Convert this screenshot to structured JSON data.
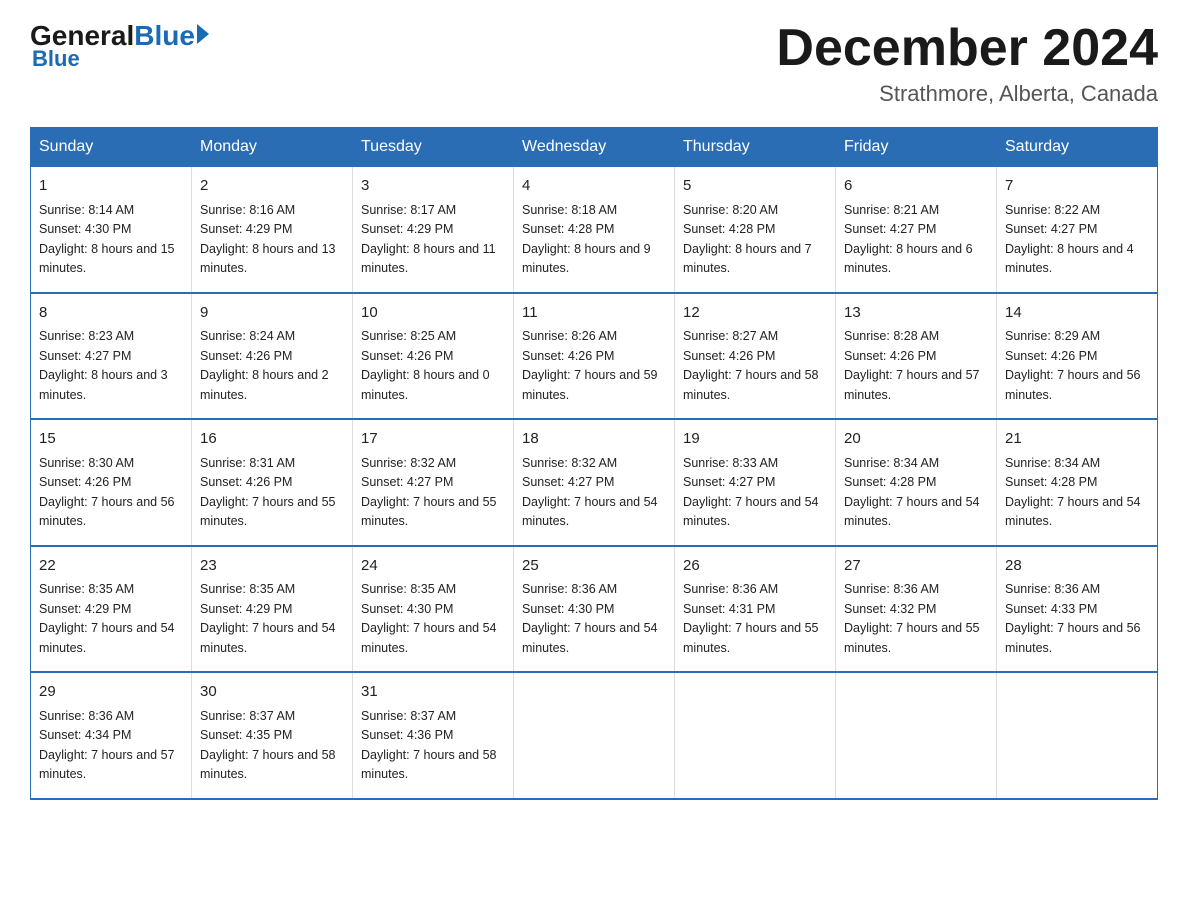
{
  "header": {
    "logo": {
      "general": "General",
      "blue": "Blue"
    },
    "title": "December 2024",
    "location": "Strathmore, Alberta, Canada"
  },
  "weekdays": [
    "Sunday",
    "Monday",
    "Tuesday",
    "Wednesday",
    "Thursday",
    "Friday",
    "Saturday"
  ],
  "weeks": [
    [
      {
        "day": "1",
        "sunrise": "Sunrise: 8:14 AM",
        "sunset": "Sunset: 4:30 PM",
        "daylight": "Daylight: 8 hours and 15 minutes."
      },
      {
        "day": "2",
        "sunrise": "Sunrise: 8:16 AM",
        "sunset": "Sunset: 4:29 PM",
        "daylight": "Daylight: 8 hours and 13 minutes."
      },
      {
        "day": "3",
        "sunrise": "Sunrise: 8:17 AM",
        "sunset": "Sunset: 4:29 PM",
        "daylight": "Daylight: 8 hours and 11 minutes."
      },
      {
        "day": "4",
        "sunrise": "Sunrise: 8:18 AM",
        "sunset": "Sunset: 4:28 PM",
        "daylight": "Daylight: 8 hours and 9 minutes."
      },
      {
        "day": "5",
        "sunrise": "Sunrise: 8:20 AM",
        "sunset": "Sunset: 4:28 PM",
        "daylight": "Daylight: 8 hours and 7 minutes."
      },
      {
        "day": "6",
        "sunrise": "Sunrise: 8:21 AM",
        "sunset": "Sunset: 4:27 PM",
        "daylight": "Daylight: 8 hours and 6 minutes."
      },
      {
        "day": "7",
        "sunrise": "Sunrise: 8:22 AM",
        "sunset": "Sunset: 4:27 PM",
        "daylight": "Daylight: 8 hours and 4 minutes."
      }
    ],
    [
      {
        "day": "8",
        "sunrise": "Sunrise: 8:23 AM",
        "sunset": "Sunset: 4:27 PM",
        "daylight": "Daylight: 8 hours and 3 minutes."
      },
      {
        "day": "9",
        "sunrise": "Sunrise: 8:24 AM",
        "sunset": "Sunset: 4:26 PM",
        "daylight": "Daylight: 8 hours and 2 minutes."
      },
      {
        "day": "10",
        "sunrise": "Sunrise: 8:25 AM",
        "sunset": "Sunset: 4:26 PM",
        "daylight": "Daylight: 8 hours and 0 minutes."
      },
      {
        "day": "11",
        "sunrise": "Sunrise: 8:26 AM",
        "sunset": "Sunset: 4:26 PM",
        "daylight": "Daylight: 7 hours and 59 minutes."
      },
      {
        "day": "12",
        "sunrise": "Sunrise: 8:27 AM",
        "sunset": "Sunset: 4:26 PM",
        "daylight": "Daylight: 7 hours and 58 minutes."
      },
      {
        "day": "13",
        "sunrise": "Sunrise: 8:28 AM",
        "sunset": "Sunset: 4:26 PM",
        "daylight": "Daylight: 7 hours and 57 minutes."
      },
      {
        "day": "14",
        "sunrise": "Sunrise: 8:29 AM",
        "sunset": "Sunset: 4:26 PM",
        "daylight": "Daylight: 7 hours and 56 minutes."
      }
    ],
    [
      {
        "day": "15",
        "sunrise": "Sunrise: 8:30 AM",
        "sunset": "Sunset: 4:26 PM",
        "daylight": "Daylight: 7 hours and 56 minutes."
      },
      {
        "day": "16",
        "sunrise": "Sunrise: 8:31 AM",
        "sunset": "Sunset: 4:26 PM",
        "daylight": "Daylight: 7 hours and 55 minutes."
      },
      {
        "day": "17",
        "sunrise": "Sunrise: 8:32 AM",
        "sunset": "Sunset: 4:27 PM",
        "daylight": "Daylight: 7 hours and 55 minutes."
      },
      {
        "day": "18",
        "sunrise": "Sunrise: 8:32 AM",
        "sunset": "Sunset: 4:27 PM",
        "daylight": "Daylight: 7 hours and 54 minutes."
      },
      {
        "day": "19",
        "sunrise": "Sunrise: 8:33 AM",
        "sunset": "Sunset: 4:27 PM",
        "daylight": "Daylight: 7 hours and 54 minutes."
      },
      {
        "day": "20",
        "sunrise": "Sunrise: 8:34 AM",
        "sunset": "Sunset: 4:28 PM",
        "daylight": "Daylight: 7 hours and 54 minutes."
      },
      {
        "day": "21",
        "sunrise": "Sunrise: 8:34 AM",
        "sunset": "Sunset: 4:28 PM",
        "daylight": "Daylight: 7 hours and 54 minutes."
      }
    ],
    [
      {
        "day": "22",
        "sunrise": "Sunrise: 8:35 AM",
        "sunset": "Sunset: 4:29 PM",
        "daylight": "Daylight: 7 hours and 54 minutes."
      },
      {
        "day": "23",
        "sunrise": "Sunrise: 8:35 AM",
        "sunset": "Sunset: 4:29 PM",
        "daylight": "Daylight: 7 hours and 54 minutes."
      },
      {
        "day": "24",
        "sunrise": "Sunrise: 8:35 AM",
        "sunset": "Sunset: 4:30 PM",
        "daylight": "Daylight: 7 hours and 54 minutes."
      },
      {
        "day": "25",
        "sunrise": "Sunrise: 8:36 AM",
        "sunset": "Sunset: 4:30 PM",
        "daylight": "Daylight: 7 hours and 54 minutes."
      },
      {
        "day": "26",
        "sunrise": "Sunrise: 8:36 AM",
        "sunset": "Sunset: 4:31 PM",
        "daylight": "Daylight: 7 hours and 55 minutes."
      },
      {
        "day": "27",
        "sunrise": "Sunrise: 8:36 AM",
        "sunset": "Sunset: 4:32 PM",
        "daylight": "Daylight: 7 hours and 55 minutes."
      },
      {
        "day": "28",
        "sunrise": "Sunrise: 8:36 AM",
        "sunset": "Sunset: 4:33 PM",
        "daylight": "Daylight: 7 hours and 56 minutes."
      }
    ],
    [
      {
        "day": "29",
        "sunrise": "Sunrise: 8:36 AM",
        "sunset": "Sunset: 4:34 PM",
        "daylight": "Daylight: 7 hours and 57 minutes."
      },
      {
        "day": "30",
        "sunrise": "Sunrise: 8:37 AM",
        "sunset": "Sunset: 4:35 PM",
        "daylight": "Daylight: 7 hours and 58 minutes."
      },
      {
        "day": "31",
        "sunrise": "Sunrise: 8:37 AM",
        "sunset": "Sunset: 4:36 PM",
        "daylight": "Daylight: 7 hours and 58 minutes."
      },
      null,
      null,
      null,
      null
    ]
  ]
}
